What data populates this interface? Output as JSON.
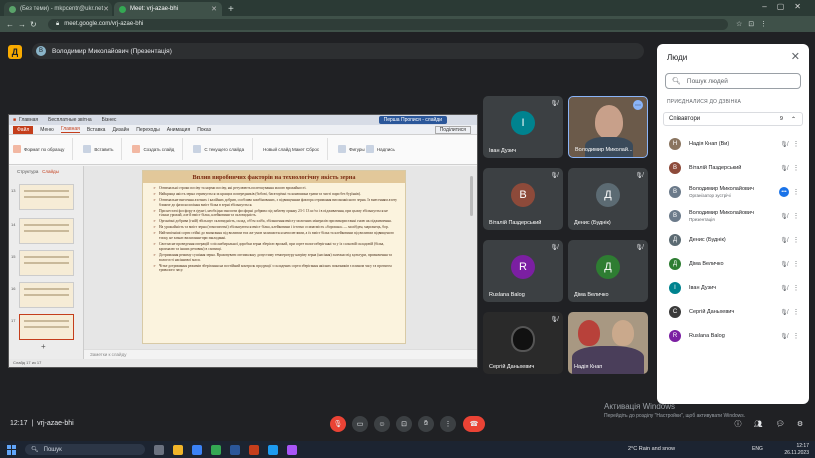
{
  "browser": {
    "tabs": [
      {
        "label": "(Без теми) - mkpcentr@ukr.net",
        "active": false
      },
      {
        "label": "Meet: vrj-azae-bhi",
        "active": true
      }
    ],
    "url": "meet.google.com/vrj-azae-bhi"
  },
  "meet": {
    "presenter_chip": "Володимир Миколайович (Презентація)",
    "presenter_initial": "В",
    "meeting_time": "12:17",
    "meeting_code": "vrj-azae-bhi",
    "tiles": [
      {
        "name": "Іван Дузич",
        "initial": "І",
        "color": "#00838f"
      },
      {
        "name": "Володимир Миколай...",
        "initial": "",
        "color": "#6b5a4a",
        "video": true
      },
      {
        "name": "Віталій Паздерський",
        "initial": "В",
        "color": "#8d4a3a"
      },
      {
        "name": "Денис (Буднік)",
        "initial": "Д",
        "color": "#5c6b73"
      },
      {
        "name": "Ruslana Balog",
        "initial": "R",
        "color": "#7b1fa2"
      },
      {
        "name": "Діма Величко",
        "initial": "Д",
        "color": "#2e7d32"
      },
      {
        "name": "Сергій Даньхевич",
        "initial": "",
        "color": "#2a2a2a",
        "video": true
      },
      {
        "name": "Надія Кнап",
        "initial": "",
        "color": "#8a7560",
        "video": true
      }
    ]
  },
  "ppt": {
    "file_tab": "Файл",
    "titlebar_tabs": [
      "Главная",
      "Бесплатные звітна",
      "Бізнес"
    ],
    "present_btn": "Перша Пропися - слайди",
    "tabs": [
      "Меню",
      "Главная",
      "Вставка",
      "Дизайн",
      "Переходы",
      "Анимация",
      "Показ"
    ],
    "share": "Поділитися",
    "ribbon_groups": [
      "Формат по образцу",
      "Вставить",
      "Создать слайд",
      "С текущего слайда",
      "Новый слайд",
      "Макет",
      "Сброс",
      "Фигуры",
      "Надпись"
    ],
    "panel_header": [
      "Структура",
      "Слайды"
    ],
    "thumb_numbers": [
      "13",
      "14",
      "15",
      "16",
      "17"
    ],
    "notes_placeholder": "Заметки к слайду",
    "status": "Слайд 17 из 17",
    "slide": {
      "title": "Вплив виробничих факторів на технологічну якість зерна",
      "bullets": [
        "Оптимальні строки посіву та норми посіву, які регулюють полегшування масою врожайності.",
        "Найкраща якість зерна отримується за кращих попередників (бобові, багаторічні та конюшина трави та чисті пари без бур'янів).",
        "Оптимальне внесення азотних і калійних добрив, особливо комбінованих, з підвищенням фактора отримання високоякісного зерна. Із внесенням азоту ближче до фази колосіння вміст білка в зерні збільшується.",
        "При нестачі фосфору в ґрунті, необхідно вносити фосфорні добрива під зяблеву оранку 23-1 13 кг/га і в підживлення, при цьому збільшується не тільки урожай, але й вміст білка, клейковини та скловидність.",
        "Органічні добрива (гній) збільшує скловидність, склад, об'єм хліба, збільшення вмісту молочних мінералів при використанні гною як підживлення.",
        "На урожайність та вміст зерна (гомозиготні) збільшуються вміст білка, клейковини і істотно осипаємість «борошна» — молібден, марганець, бор.",
        "Найтипічніші сорти стійкі до вилягання під впливом тих же умов залишається неполеглими, а їх вміст білка та клейковини під впливом підвищеного тиску, не зазнає вилягання-при закладанні.",
        "Своєчасне проведення операцій з післязбиральної доробки зерна зберігає врожай, при сорте вологозберіганні та у їх сольовій складовій (білка, крохмалю та інших речовин) в сховищі.",
        "Дотримання режиму сушіння зерна. Враховувати оптимальну допустиму температуру нагріву зерна (насіння) залежно від культури, призначення та вологості насіннєвої маси.",
        "Чітке дотримання режимів зберігання на постійний контроль продукції з складених сорти зберігання якісних показників з плином часу та протягом тривалого часу."
      ]
    }
  },
  "people": {
    "title": "Люди",
    "search_placeholder": "Пошук людей",
    "section": "ПРИЄДНАЛИСЯ ДО ДЗВІНКА",
    "group_label": "Співавтори",
    "group_count": "9",
    "list": [
      {
        "name": "Надія Кнап (Ви)",
        "role": "",
        "initial": "Н",
        "color": "#8a7560",
        "mic": "muted"
      },
      {
        "name": "Віталій Паздерський",
        "role": "",
        "initial": "В",
        "color": "#8d4a3a",
        "mic": "muted"
      },
      {
        "name": "Володимир Миколайович",
        "role": "Організатор зустрічі",
        "initial": "В",
        "color": "#6b7a8a",
        "mic": "speaking"
      },
      {
        "name": "Володимир Миколайович",
        "role": "Презентація",
        "initial": "В",
        "color": "#6b7a8a",
        "mic": "muted"
      },
      {
        "name": "Денис (Буднік)",
        "role": "",
        "initial": "Д",
        "color": "#5c6b73",
        "mic": "muted"
      },
      {
        "name": "Діма Величко",
        "role": "",
        "initial": "Д",
        "color": "#2e7d32",
        "mic": "muted"
      },
      {
        "name": "Іван Дузич",
        "role": "",
        "initial": "І",
        "color": "#00838f",
        "mic": "muted"
      },
      {
        "name": "Сергій Даньхевич",
        "role": "",
        "initial": "С",
        "color": "#3a3a3a",
        "mic": "muted"
      },
      {
        "name": "Ruslana Balog",
        "role": "",
        "initial": "R",
        "color": "#7b1fa2",
        "mic": "muted"
      }
    ]
  },
  "windows": {
    "activation_title": "Активація Windows",
    "activation_sub": "Перейдіть до розділу \"Настройки\", щоб активувати Windows.",
    "search": "Пошук",
    "weather": "2°C Rain and snow",
    "lang": "ENG",
    "clock_time": "12:17",
    "clock_date": "26.11.2023"
  },
  "icons": {
    "mic_off": "mic-off-icon",
    "more": "more-vert-icon"
  }
}
